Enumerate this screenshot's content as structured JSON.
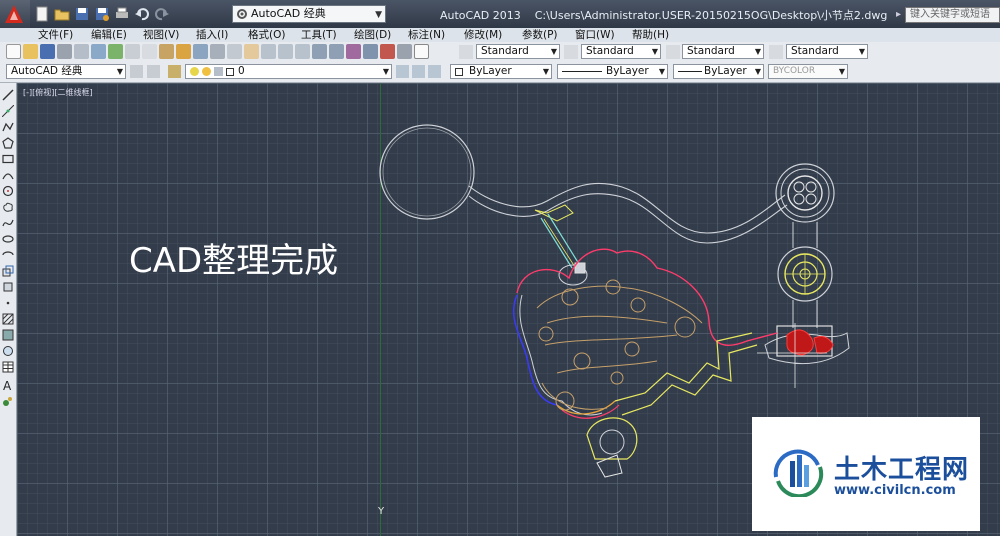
{
  "titlebar": {
    "app_title": "AutoCAD 2013",
    "file_path": "C:\\Users\\Administrator.USER-20150215OG\\Desktop\\小节点2.dwg",
    "workspace": "AutoCAD 经典",
    "search_placeholder": "键入关键字或短语"
  },
  "menubar": {
    "items": [
      "文件(F)",
      "编辑(E)",
      "视图(V)",
      "插入(I)",
      "格式(O)",
      "工具(T)",
      "绘图(D)",
      "标注(N)",
      "修改(M)",
      "参数(P)",
      "窗口(W)",
      "帮助(H)"
    ]
  },
  "styles_toolbar": {
    "text_style": "Standard",
    "dim_style": "Standard",
    "table_style": "Standard",
    "mleader_style": "Standard"
  },
  "layers_toolbar": {
    "workspace": "AutoCAD 经典",
    "layer": "0",
    "color": "ByLayer",
    "linetype": "ByLayer",
    "lineweight": "ByLayer",
    "plot_style": "BYCOLOR"
  },
  "canvas": {
    "viewport_label": "[-][俯视][二维线框]",
    "annotation": "CAD整理完成",
    "y_axis_label": "Y"
  },
  "watermark": {
    "name": "土木工程网",
    "url": "www.civilcn.com"
  },
  "colors": {
    "canvas_bg": "#333c4a",
    "app_icon": "#d42a1e",
    "watermark_blue": "#1b4f9c"
  }
}
